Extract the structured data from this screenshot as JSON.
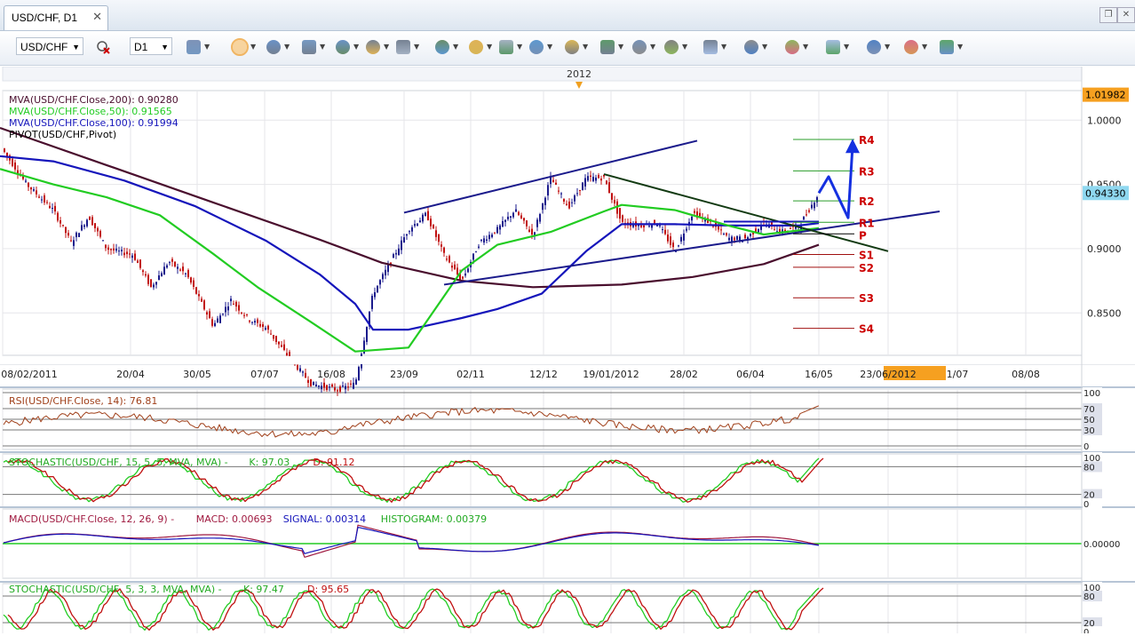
{
  "tab": {
    "title": "USD/CHF, D1",
    "close": "✕"
  },
  "toolbar": {
    "symbol": "USD/CHF",
    "timeframe": "D1",
    "icons": [
      "chart-type-icon",
      "indicator-remove-icon",
      "bar-chart-icon",
      "candle-chart-icon",
      "line-chart-icon",
      "crosshair-icon",
      "zoom-icon",
      "cursor-icon",
      "period-separator-icon",
      "edit-icon",
      "refresh-icon",
      "globe-icon",
      "ruler-icon",
      "image-icon",
      "template-icon",
      "fibonacci-icon",
      "channel-icon",
      "trendline-icon",
      "pencil-icon",
      "ellipse-icon",
      "text-icon",
      "eraser-icon",
      "tree-icon"
    ]
  },
  "chart_data": [
    {
      "type": "line",
      "panel": "price",
      "title": "USD/CHF, D1",
      "indicators": [
        {
          "label": "MVA(USD/CHF.Close,200): 0.90280",
          "color": "#4a0f2e"
        },
        {
          "label": "MVA(USD/CHF.Close,50): 0.91565",
          "color": "#22cc22"
        },
        {
          "label": "MVA(USD/CHF.Close,100): 0.91994",
          "color": "#1515bb"
        },
        {
          "label": "PIVOT(USD/CHF,Pivot)",
          "color": "#000000"
        }
      ],
      "ylim": [
        0.817,
        1.023
      ],
      "yticks": [
        "1.0000",
        "0.9500",
        "0.9000",
        "0.8500"
      ],
      "ytick_values": [
        1.0,
        0.95,
        0.9,
        0.85
      ],
      "current_price": "0.94330",
      "current_value": 0.9433,
      "top_marker": "1.01982",
      "top_value": 1.01982,
      "year_label": "2012",
      "xtick_labels": [
        "08/02/2011",
        "20/04",
        "30/05",
        "07/07",
        "16/08",
        "23/09",
        "02/11",
        "12/12",
        "19/01/2012",
        "28/02",
        "06/04",
        "16/05",
        "23/06/2012",
        "1/07",
        "08/08"
      ],
      "pivot_levels": [
        {
          "label": "R4",
          "value": 0.985,
          "color": "#2a9d2a"
        },
        {
          "label": "R3",
          "value": 0.9605,
          "color": "#2a9d2a"
        },
        {
          "label": "R2",
          "value": 0.9372,
          "color": "#2a9d2a"
        },
        {
          "label": "R1",
          "value": 0.9205,
          "color": "#2a9d2a"
        },
        {
          "label": "P",
          "value": 0.9115,
          "color": "#000000"
        },
        {
          "label": "S1",
          "value": 0.8955,
          "color": "#a01010"
        },
        {
          "label": "S2",
          "value": 0.8855,
          "color": "#a01010"
        },
        {
          "label": "S3",
          "value": 0.8618,
          "color": "#a01010"
        },
        {
          "label": "S4",
          "value": 0.838,
          "color": "#a01010"
        }
      ],
      "ma200": [
        [
          0,
          0.994
        ],
        [
          120,
          0.965
        ],
        [
          240,
          0.936
        ],
        [
          360,
          0.907
        ],
        [
          430,
          0.889
        ],
        [
          520,
          0.875
        ],
        [
          600,
          0.87
        ],
        [
          700,
          0.872
        ],
        [
          780,
          0.878
        ],
        [
          860,
          0.888
        ],
        [
          922,
          0.903
        ]
      ],
      "ma50": [
        [
          0,
          0.962
        ],
        [
          60,
          0.95
        ],
        [
          120,
          0.94
        ],
        [
          180,
          0.926
        ],
        [
          240,
          0.896
        ],
        [
          290,
          0.87
        ],
        [
          350,
          0.843
        ],
        [
          400,
          0.82
        ],
        [
          460,
          0.823
        ],
        [
          520,
          0.883
        ],
        [
          560,
          0.903
        ],
        [
          620,
          0.913
        ],
        [
          680,
          0.929
        ],
        [
          700,
          0.934
        ],
        [
          760,
          0.93
        ],
        [
          820,
          0.918
        ],
        [
          860,
          0.911
        ],
        [
          922,
          0.916
        ]
      ],
      "ma100": [
        [
          0,
          0.972
        ],
        [
          60,
          0.968
        ],
        [
          140,
          0.953
        ],
        [
          220,
          0.933
        ],
        [
          300,
          0.906
        ],
        [
          360,
          0.88
        ],
        [
          400,
          0.857
        ],
        [
          420,
          0.837
        ],
        [
          460,
          0.837
        ],
        [
          520,
          0.846
        ],
        [
          560,
          0.853
        ],
        [
          610,
          0.865
        ],
        [
          660,
          0.898
        ],
        [
          700,
          0.919
        ],
        [
          760,
          0.919
        ],
        [
          820,
          0.918
        ],
        [
          900,
          0.918
        ],
        [
          922,
          0.9199
        ]
      ],
      "price": [
        [
          5,
          0.975
        ],
        [
          30,
          0.95
        ],
        [
          60,
          0.93
        ],
        [
          80,
          0.905
        ],
        [
          100,
          0.925
        ],
        [
          120,
          0.9
        ],
        [
          150,
          0.895
        ],
        [
          170,
          0.87
        ],
        [
          190,
          0.89
        ],
        [
          210,
          0.88
        ],
        [
          225,
          0.86
        ],
        [
          240,
          0.84
        ],
        [
          260,
          0.86
        ],
        [
          280,
          0.845
        ],
        [
          300,
          0.838
        ],
        [
          320,
          0.82
        ],
        [
          350,
          0.795
        ],
        [
          380,
          0.79
        ],
        [
          400,
          0.795
        ],
        [
          420,
          0.865
        ],
        [
          440,
          0.89
        ],
        [
          460,
          0.915
        ],
        [
          480,
          0.927
        ],
        [
          500,
          0.895
        ],
        [
          520,
          0.875
        ],
        [
          540,
          0.905
        ],
        [
          560,
          0.915
        ],
        [
          580,
          0.93
        ],
        [
          600,
          0.91
        ],
        [
          620,
          0.955
        ],
        [
          640,
          0.932
        ],
        [
          660,
          0.955
        ],
        [
          680,
          0.955
        ],
        [
          700,
          0.92
        ],
        [
          720,
          0.918
        ],
        [
          740,
          0.92
        ],
        [
          760,
          0.898
        ],
        [
          780,
          0.928
        ],
        [
          800,
          0.92
        ],
        [
          820,
          0.908
        ],
        [
          840,
          0.908
        ],
        [
          860,
          0.92
        ],
        [
          880,
          0.913
        ],
        [
          900,
          0.918
        ],
        [
          922,
          0.9433
        ]
      ],
      "trend_lines": [
        {
          "p1": [
            455,
            0.928
          ],
          "p2": [
            785,
            0.984
          ],
          "color": "#1b1b8c"
        },
        {
          "p1": [
            500,
            0.872
          ],
          "p2": [
            1058,
            0.929
          ],
          "color": "#1b1b8c"
        },
        {
          "p1": [
            680,
            0.958
          ],
          "p2": [
            1000,
            0.898
          ],
          "color": "#123a12"
        }
      ],
      "projection": [
        [
          922,
          0.9433
        ],
        [
          933,
          0.956
        ],
        [
          955,
          0.924
        ],
        [
          960,
          0.98
        ]
      ],
      "hline": {
        "value": 0.921,
        "x1": 815,
        "x2": 922
      }
    },
    {
      "type": "line",
      "panel": "rsi",
      "label": "RSI(USD/CHF.Close, 14): 76.81",
      "value": 76.81,
      "color": "#a0401a",
      "ylim": [
        0,
        100
      ],
      "levels": [
        100,
        70,
        50,
        30,
        0
      ],
      "yticks": [
        "100",
        "70",
        "50",
        "30",
        "0"
      ]
    },
    {
      "type": "line",
      "panel": "stoch1",
      "label": "STOCHASTIC(USD/CHF, 15, 5, 5, MVA, MVA) -",
      "k_label": "K: 97.03",
      "d_label": "D: 91.12",
      "k": 97.03,
      "d": 91.12,
      "ylim": [
        0,
        100
      ],
      "levels": [
        80,
        20
      ],
      "yticks": [
        "100",
        "80",
        "20",
        "0"
      ]
    },
    {
      "type": "line",
      "panel": "macd",
      "label": "MACD(USD/CHF.Close, 12, 26, 9) -",
      "macd_label": "MACD: 0.00693",
      "signal_label": "SIGNAL: 0.00314",
      "hist_label": "HISTOGRAM: 0.00379",
      "macd": 0.00693,
      "signal": 0.00314,
      "histogram": 0.00379,
      "yticks": [
        "0.00000"
      ]
    },
    {
      "type": "line",
      "panel": "stoch2",
      "label": "STOCHASTIC(USD/CHF, 5, 3, 3, MVA, MVA) -",
      "k_label": "K: 97.47",
      "d_label": "D: 95.65",
      "k": 97.47,
      "d": 95.65,
      "ylim": [
        0,
        100
      ],
      "levels": [
        80,
        20
      ],
      "yticks": [
        "100",
        "80",
        "20",
        "0"
      ]
    }
  ],
  "colors": {
    "price_up": "#1b1b8c",
    "price_down": "#c11010",
    "grid": "#e6e6ea",
    "axis_bg": "#ffffff",
    "current_price_bg": "#8fd8f0",
    "top_marker_bg": "#f6a020",
    "date_highlight_bg": "#f6a020"
  }
}
